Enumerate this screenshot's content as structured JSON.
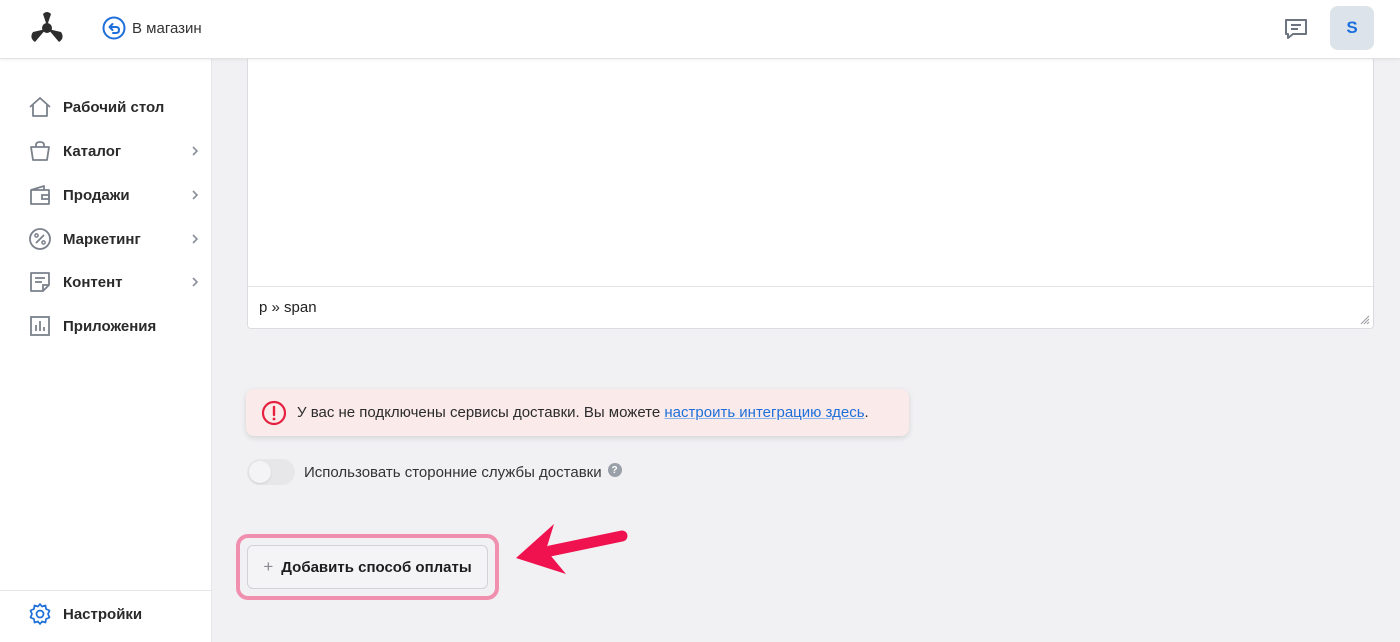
{
  "header": {
    "back_label": "В магазин",
    "avatar_initial": "S"
  },
  "sidebar": {
    "items": [
      {
        "label": "Рабочий стол",
        "icon": "home-icon",
        "has_submenu": false
      },
      {
        "label": "Каталог",
        "icon": "shopping-bag-icon",
        "has_submenu": true
      },
      {
        "label": "Продажи",
        "icon": "wallet-icon",
        "has_submenu": true
      },
      {
        "label": "Маркетинг",
        "icon": "percent-icon",
        "has_submenu": true
      },
      {
        "label": "Контент",
        "icon": "document-icon",
        "has_submenu": true
      },
      {
        "label": "Приложения",
        "icon": "bar-chart-icon",
        "has_submenu": false
      }
    ],
    "settings_label": "Настройки"
  },
  "editor": {
    "element_path": "p » span"
  },
  "alert": {
    "message": "У вас не подключены сервисы доставки. Вы можете ",
    "link_text": "настроить интеграцию здесь",
    "suffix": "."
  },
  "delivery_toggle": {
    "label": "Использовать сторонние службы доставки",
    "enabled": false
  },
  "add_payment_button": {
    "label": "Добавить способ оплаты"
  },
  "colors": {
    "accent": "#1e6fd9",
    "alert_bg": "#fbeaea",
    "error": "#e5213f",
    "highlight": "#f08fae",
    "arrow": "#f0124f"
  }
}
